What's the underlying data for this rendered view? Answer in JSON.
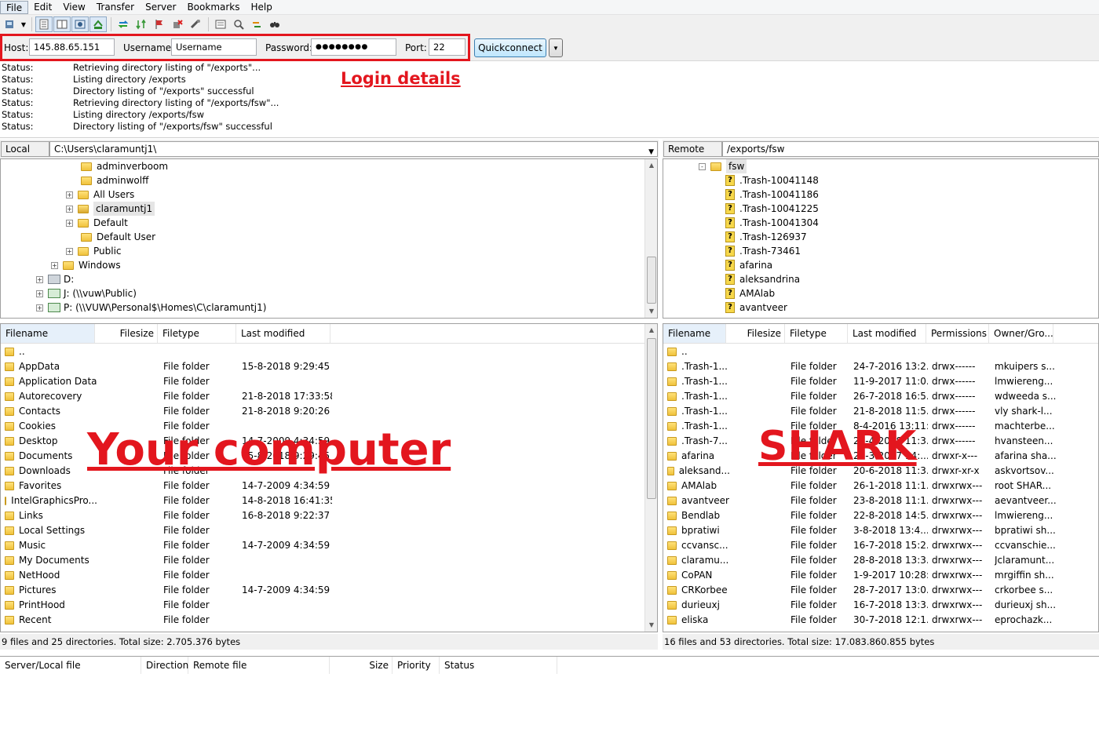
{
  "menu": [
    "File",
    "Edit",
    "View",
    "Transfer",
    "Server",
    "Bookmarks",
    "Help"
  ],
  "toolbar_icons": [
    "site-manager-icon",
    "toggle-log-icon",
    "toggle-local-tree-icon",
    "toggle-remote-tree-icon",
    "toggle-queue-icon",
    "refresh-icon",
    "process-queue-icon",
    "cancel-icon",
    "disconnect-icon",
    "reconnect-icon",
    "filter-icon",
    "compare-icon",
    "sync-browse-icon",
    "search-icon"
  ],
  "quickconnect": {
    "host_label": "Host:",
    "host_value": "145.88.65.151",
    "username_label": "Username:",
    "username_value": "Username",
    "password_label": "Password:",
    "password_value": "●●●●●●●●",
    "port_label": "Port:",
    "port_value": "22",
    "button_label": "Quickconnect"
  },
  "annotations": {
    "login": "Login details",
    "local": "Your computer",
    "remote": "SHARK"
  },
  "highlight_color": "#e3161e",
  "status_log": [
    {
      "key": "Status:",
      "msg": "Retrieving directory listing of \"/exports\"..."
    },
    {
      "key": "Status:",
      "msg": "Listing directory /exports"
    },
    {
      "key": "Status:",
      "msg": "Directory listing of \"/exports\" successful"
    },
    {
      "key": "Status:",
      "msg": "Retrieving directory listing of \"/exports/fsw\"..."
    },
    {
      "key": "Status:",
      "msg": "Listing directory /exports/fsw"
    },
    {
      "key": "Status:",
      "msg": "Directory listing of \"/exports/fsw\" successful"
    }
  ],
  "local_site": {
    "label": "Local site:",
    "path": "C:\\Users\\claramuntj1\\",
    "tree": [
      {
        "name": "adminverboom",
        "icon": "folder-icon",
        "expander": ""
      },
      {
        "name": "adminwolff",
        "icon": "folder-icon",
        "expander": ""
      },
      {
        "name": "All Users",
        "icon": "folder-icon",
        "expander": "+"
      },
      {
        "name": "claramuntj1",
        "icon": "user-folder-icon",
        "expander": "+"
      },
      {
        "name": "Default",
        "icon": "folder-icon",
        "expander": "+"
      },
      {
        "name": "Default User",
        "icon": "folder-icon",
        "expander": ""
      },
      {
        "name": "Public",
        "icon": "folder-icon",
        "expander": "+"
      },
      {
        "name": "Windows",
        "icon": "folder-icon",
        "expander": "+"
      },
      {
        "name": "D:",
        "icon": "drive-icon",
        "expander": "+"
      },
      {
        "name": "J: (\\\\vuw\\Public)",
        "icon": "network-drive-icon",
        "expander": "+"
      },
      {
        "name": "P: (\\\\VUW\\Personal$\\Homes\\C\\claramuntj1)",
        "icon": "network-drive-icon",
        "expander": "+"
      }
    ],
    "columns": [
      "Filename",
      "Filesize",
      "Filetype",
      "Last modified"
    ],
    "files": [
      {
        "name": "..",
        "size": "",
        "type": "",
        "modified": ""
      },
      {
        "name": "AppData",
        "size": "",
        "type": "File folder",
        "modified": "15-8-2018 9:29:45"
      },
      {
        "name": "Application Data",
        "size": "",
        "type": "File folder",
        "modified": ""
      },
      {
        "name": "Autorecovery",
        "size": "",
        "type": "File folder",
        "modified": "21-8-2018 17:33:58"
      },
      {
        "name": "Contacts",
        "size": "",
        "type": "File folder",
        "modified": "21-8-2018 9:20:26"
      },
      {
        "name": "Cookies",
        "size": "",
        "type": "File folder",
        "modified": ""
      },
      {
        "name": "Desktop",
        "size": "",
        "type": "File folder",
        "modified": "14-7-2009 4:34:59"
      },
      {
        "name": "Documents",
        "size": "",
        "type": "File folder",
        "modified": "15-8-2018 9:29:45"
      },
      {
        "name": "Downloads",
        "size": "",
        "type": "File folder",
        "modified": ""
      },
      {
        "name": "Favorites",
        "size": "",
        "type": "File folder",
        "modified": "14-7-2009 4:34:59"
      },
      {
        "name": "IntelGraphicsPro...",
        "size": "",
        "type": "File folder",
        "modified": "14-8-2018 16:41:35"
      },
      {
        "name": "Links",
        "size": "",
        "type": "File folder",
        "modified": "16-8-2018 9:22:37"
      },
      {
        "name": "Local Settings",
        "size": "",
        "type": "File folder",
        "modified": ""
      },
      {
        "name": "Music",
        "size": "",
        "type": "File folder",
        "modified": "14-7-2009 4:34:59"
      },
      {
        "name": "My Documents",
        "size": "",
        "type": "File folder",
        "modified": ""
      },
      {
        "name": "NetHood",
        "size": "",
        "type": "File folder",
        "modified": ""
      },
      {
        "name": "Pictures",
        "size": "",
        "type": "File folder",
        "modified": "14-7-2009 4:34:59"
      },
      {
        "name": "PrintHood",
        "size": "",
        "type": "File folder",
        "modified": ""
      },
      {
        "name": "Recent",
        "size": "",
        "type": "File folder",
        "modified": ""
      }
    ],
    "summary": "9 files and 25 directories. Total size: 2.705.376 bytes"
  },
  "remote_site": {
    "label": "Remote site:",
    "path": "/exports/fsw",
    "tree": [
      {
        "name": "fsw",
        "icon": "folder-icon",
        "expander": "-"
      },
      {
        "name": ".Trash-10041148",
        "icon": "question-icon",
        "expander": ""
      },
      {
        "name": ".Trash-10041186",
        "icon": "question-icon",
        "expander": ""
      },
      {
        "name": ".Trash-10041225",
        "icon": "question-icon",
        "expander": ""
      },
      {
        "name": ".Trash-10041304",
        "icon": "question-icon",
        "expander": ""
      },
      {
        "name": ".Trash-126937",
        "icon": "question-icon",
        "expander": ""
      },
      {
        "name": ".Trash-73461",
        "icon": "question-icon",
        "expander": ""
      },
      {
        "name": "afarina",
        "icon": "question-icon",
        "expander": ""
      },
      {
        "name": "aleksandrina",
        "icon": "question-icon",
        "expander": ""
      },
      {
        "name": "AMAlab",
        "icon": "question-icon",
        "expander": ""
      },
      {
        "name": "avantveer",
        "icon": "question-icon",
        "expander": ""
      }
    ],
    "columns": [
      "Filename",
      "Filesize",
      "Filetype",
      "Last modified",
      "Permissions",
      "Owner/Gro..."
    ],
    "files": [
      {
        "name": "..",
        "size": "",
        "type": "",
        "modified": "",
        "perms": "",
        "owner": ""
      },
      {
        "name": ".Trash-1...",
        "size": "",
        "type": "File folder",
        "modified": "24-7-2016 13:2...",
        "perms": "drwx------",
        "owner": "mkuipers s..."
      },
      {
        "name": ".Trash-1...",
        "size": "",
        "type": "File folder",
        "modified": "11-9-2017 11:0...",
        "perms": "drwx------",
        "owner": "lmwiereng..."
      },
      {
        "name": ".Trash-1...",
        "size": "",
        "type": "File folder",
        "modified": "26-7-2018 16:5...",
        "perms": "drwx------",
        "owner": "wdweeda s..."
      },
      {
        "name": ".Trash-1...",
        "size": "",
        "type": "File folder",
        "modified": "21-8-2018 11:5...",
        "perms": "drwx------",
        "owner": "vly shark-l..."
      },
      {
        "name": ".Trash-1...",
        "size": "",
        "type": "File folder",
        "modified": "8-4-2016 13:11:...",
        "perms": "drwx------",
        "owner": "machterbe..."
      },
      {
        "name": ".Trash-7...",
        "size": "",
        "type": "File folder",
        "modified": "25-4-2018 11:3...",
        "perms": "drwx------",
        "owner": "hvansteen..."
      },
      {
        "name": "afarina",
        "size": "",
        "type": "File folder",
        "modified": "20-3-2017 14:...",
        "perms": "drwxr-x---",
        "owner": "afarina sha..."
      },
      {
        "name": "aleksand...",
        "size": "",
        "type": "File folder",
        "modified": "20-6-2018 11:3...",
        "perms": "drwxr-xr-x",
        "owner": "askvortsov..."
      },
      {
        "name": "AMAlab",
        "size": "",
        "type": "File folder",
        "modified": "26-1-2018 11:1...",
        "perms": "drwxrwx---",
        "owner": "root SHAR..."
      },
      {
        "name": "avantveer",
        "size": "",
        "type": "File folder",
        "modified": "23-8-2018 11:1...",
        "perms": "drwxrwx---",
        "owner": "aevantveer..."
      },
      {
        "name": "Bendlab",
        "size": "",
        "type": "File folder",
        "modified": "22-8-2018 14:5...",
        "perms": "drwxrwx---",
        "owner": "lmwiereng..."
      },
      {
        "name": "bpratiwi",
        "size": "",
        "type": "File folder",
        "modified": "3-8-2018 13:4...",
        "perms": "drwxrwx---",
        "owner": "bpratiwi sh..."
      },
      {
        "name": "ccvansc...",
        "size": "",
        "type": "File folder",
        "modified": "16-7-2018 15:2...",
        "perms": "drwxrwx---",
        "owner": "ccvanschie..."
      },
      {
        "name": "claramu...",
        "size": "",
        "type": "File folder",
        "modified": "28-8-2018 13:3...",
        "perms": "drwxrwx---",
        "owner": "Jclaramunt..."
      },
      {
        "name": "CoPAN",
        "size": "",
        "type": "File folder",
        "modified": "1-9-2017 10:28:...",
        "perms": "drwxrwx---",
        "owner": "mrgiffin sh..."
      },
      {
        "name": "CRKorbee",
        "size": "",
        "type": "File folder",
        "modified": "28-7-2017 13:0...",
        "perms": "drwxrwx---",
        "owner": "crkorbee s..."
      },
      {
        "name": "durieuxj",
        "size": "",
        "type": "File folder",
        "modified": "16-7-2018 13:3...",
        "perms": "drwxrwx---",
        "owner": "durieuxj sh..."
      },
      {
        "name": "eliska",
        "size": "",
        "type": "File folder",
        "modified": "30-7-2018 12:1...",
        "perms": "drwxrwx---",
        "owner": "eprochazk..."
      }
    ],
    "summary": "16 files and 53 directories. Total size: 17.083.860.855 bytes"
  },
  "queue_columns": [
    "Server/Local file",
    "Direction",
    "Remote file",
    "Size",
    "Priority",
    "Status"
  ]
}
